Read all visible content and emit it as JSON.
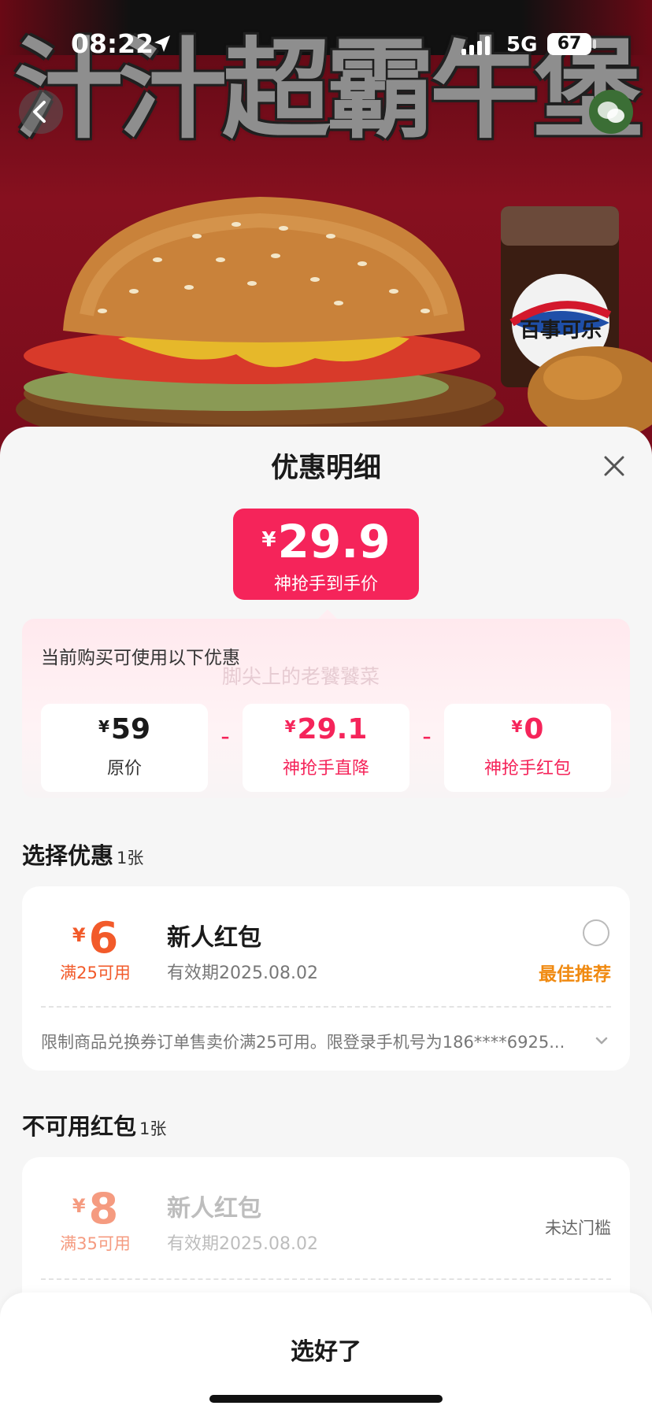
{
  "status_bar": {
    "time": "08:22",
    "network": "5G",
    "battery": "67"
  },
  "hero": {
    "headline": "汁汁超霸牛堡",
    "cup_brand": "百事可乐"
  },
  "sheet": {
    "title": "优惠明细",
    "final_price": {
      "currency": "¥",
      "amount": "29.9",
      "label": "神抢手到手价"
    },
    "breakdown": {
      "caption": "当前购买可使用以下优惠",
      "watermark": "脚尖上的老饕饕菜",
      "minus": "-",
      "items": [
        {
          "currency": "¥",
          "amount": "59",
          "label": "原价"
        },
        {
          "currency": "¥",
          "amount": "29.1",
          "label": "神抢手直降"
        },
        {
          "currency": "¥",
          "amount": "0",
          "label": "神抢手红包"
        }
      ]
    },
    "select_section": {
      "title": "选择优惠",
      "count": "1张",
      "coupon": {
        "currency": "¥",
        "amount": "6",
        "threshold": "满25可用",
        "name": "新人红包",
        "validity": "有效期2025.08.02",
        "tag": "最佳推荐",
        "rule": "限制商品兑换券订单售卖价满25可用。限登录手机号为186****6925..."
      }
    },
    "unavailable_section": {
      "title": "不可用红包",
      "count": "1张",
      "coupon": {
        "currency": "¥",
        "amount": "8",
        "threshold": "满35可用",
        "name": "新人红包",
        "validity": "有效期2025.08.02",
        "status": "未达门槛"
      }
    },
    "confirm_label": "选好了"
  },
  "colors": {
    "accent": "#f5245a",
    "coupon_red": "#f25a2a",
    "recommend_orange": "#f08a11"
  }
}
